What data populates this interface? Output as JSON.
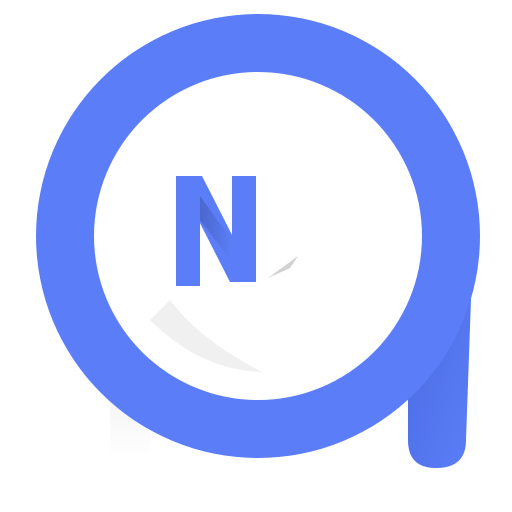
{
  "logo": {
    "letter": "N",
    "colors": {
      "brand": "#5b7ef8",
      "brand_dark": "#4a6ae0",
      "inner": "#ffffff"
    },
    "icons": {
      "mark": "app-logo-icon"
    }
  }
}
